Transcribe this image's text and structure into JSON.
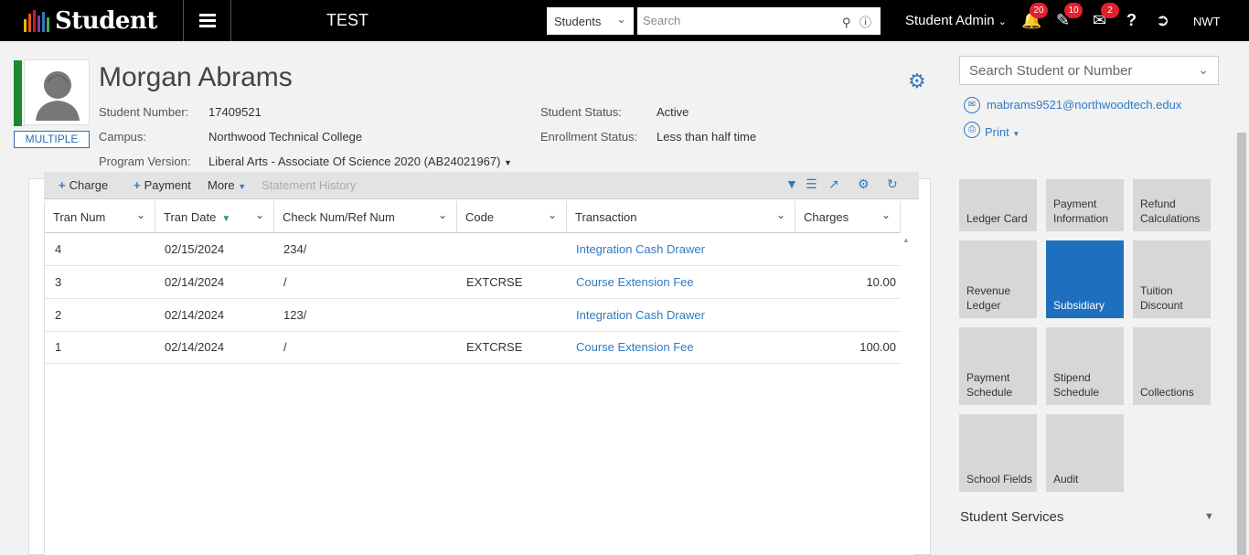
{
  "topbar": {
    "logo_text": "Student",
    "environment": "TEST",
    "scope_select": "Students",
    "search_placeholder": "Search",
    "user_menu": "Student Admin",
    "notifications_count": "20",
    "tasks_count": "10",
    "messages_count": "2",
    "help_label": "?",
    "org_code": "NWT"
  },
  "student": {
    "name": "Morgan Abrams",
    "badge": "MULTIPLE",
    "number_label": "Student Number:",
    "number": "17409521",
    "campus_label": "Campus:",
    "campus": "Northwood Technical College",
    "program_label": "Program Version:",
    "program": "Liberal Arts - Associate Of Science 2020 (AB24021967)",
    "status_label": "Student Status:",
    "status": "Active",
    "enrollment_label": "Enrollment Status:",
    "enrollment": "Less than half time"
  },
  "side": {
    "search_placeholder": "Search Student or Number",
    "email": "mabrams9521@northwoodtech.edux",
    "print_label": "Print"
  },
  "toolbar": {
    "charge": "Charge",
    "payment": "Payment",
    "more": "More",
    "statement_history": "Statement History"
  },
  "grid": {
    "columns": [
      "Tran Num",
      "Tran Date",
      "Check Num/Ref Num",
      "Code",
      "Transaction",
      "Charges"
    ],
    "rows": [
      {
        "tran_num": "4",
        "date": "02/15/2024",
        "ref": "234/",
        "code": "",
        "transaction": "Integration Cash Drawer",
        "charges": ""
      },
      {
        "tran_num": "3",
        "date": "02/14/2024",
        "ref": "/",
        "code": "EXTCRSE",
        "transaction": "Course Extension Fee",
        "charges": "10.00"
      },
      {
        "tran_num": "2",
        "date": "02/14/2024",
        "ref": "123/",
        "code": "",
        "transaction": "Integration Cash Drawer",
        "charges": ""
      },
      {
        "tran_num": "1",
        "date": "02/14/2024",
        "ref": "/",
        "code": "EXTCRSE",
        "transaction": "Course Extension Fee",
        "charges": "100.00"
      }
    ]
  },
  "tiles": [
    {
      "label": "Ledger Card",
      "active": false
    },
    {
      "label": "Payment Information",
      "active": false
    },
    {
      "label": "Refund Calculations",
      "active": false
    },
    {
      "label": "Revenue Ledger",
      "active": false
    },
    {
      "label": "Subsidiary",
      "active": true
    },
    {
      "label": "Tuition Discount",
      "active": false
    },
    {
      "label": "Payment Schedule",
      "active": false
    },
    {
      "label": "Stipend Schedule",
      "active": false
    },
    {
      "label": "Collections",
      "active": false
    },
    {
      "label": "School Fields",
      "active": false
    },
    {
      "label": "Audit",
      "active": false
    }
  ],
  "services_label": "Student Services",
  "colors": {
    "accent": "#2f7ac2",
    "active_tile": "#1f6fbf",
    "status_green": "#1b8a2e",
    "badge_red": "#e5202e"
  }
}
